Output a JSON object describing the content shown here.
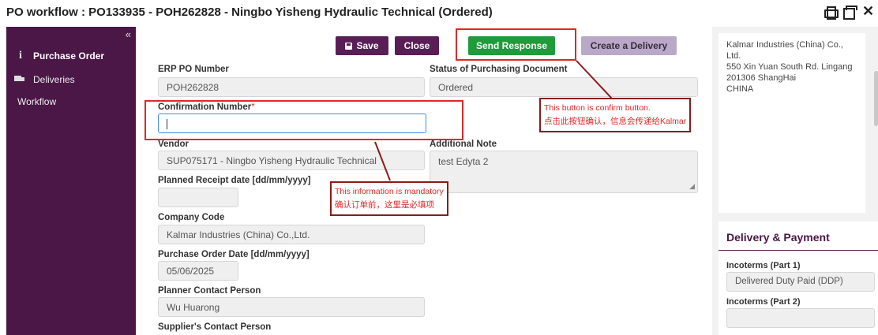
{
  "window": {
    "title": "PO workflow : PO133935 - POH262828 - Ningbo Yisheng Hydraulic Technical (Ordered)",
    "icons": [
      "print-icon",
      "window-icon",
      "close-icon"
    ],
    "close_glyph": "✕"
  },
  "sidebar": {
    "collapse_glyph": "«",
    "items": [
      {
        "label": "Purchase Order",
        "icon": "info-icon",
        "active": true
      },
      {
        "label": "Deliveries",
        "icon": "truck-icon",
        "active": false
      },
      {
        "label": "Workflow",
        "icon": "",
        "active": false
      }
    ]
  },
  "toolbar": {
    "save_label": "Save",
    "close_label": "Close",
    "send_label": "Send Response",
    "delivery_label": "Create a Delivery"
  },
  "form": {
    "erp_po_number_label": "ERP PO Number",
    "erp_po_number_value": "POH262828",
    "status_label": "Status of Purchasing Document",
    "status_value": "Ordered",
    "confirmation_label": "Confirmation Number",
    "confirmation_required": "*",
    "confirmation_value": "",
    "vendor_label": "Vendor",
    "vendor_value": "SUP075171 - Ningbo Yisheng Hydraulic Technical",
    "additional_note_label": "Additional Note",
    "additional_note_value": "test Edyta 2",
    "planned_receipt_label": "Planned Receipt date [dd/mm/yyyy]",
    "planned_receipt_value": "",
    "company_code_label": "Company Code",
    "company_code_value": "Kalmar Industries (China) Co.,Ltd.",
    "po_date_label": "Purchase Order Date [dd/mm/yyyy]",
    "po_date_value": "05/06/2025",
    "planner_label": "Planner Contact Person",
    "planner_value": "Wu Huarong",
    "supplier_contact_label": "Supplier's Contact Person"
  },
  "annotations": {
    "send_note_line1": "This button is confirm button.",
    "send_note_line2": "点击此按钮确认，信息会传递给Kalmar",
    "mandatory_note_line1": "This information is mandatory",
    "mandatory_note_line2": "确认订单前，这里是必填项",
    "color": "#e32626"
  },
  "address": {
    "line1": "Kalmar Industries (China) Co., Ltd.",
    "line2": "550 Xin Yuan South Rd. Lingang",
    "line3": "201306 ShangHai",
    "line4": "CHINA"
  },
  "delivery_payment": {
    "title": "Delivery & Payment",
    "incoterms1_label": "Incoterms (Part 1)",
    "incoterms1_value": "Delivered Duty Paid (DDP)",
    "incoterms2_label": "Incoterms (Part 2)",
    "incoterms2_value": ""
  },
  "colors": {
    "brand": "#4a1747",
    "send_button": "#1e9c3a",
    "delivery_button": "#b9a8c7"
  }
}
